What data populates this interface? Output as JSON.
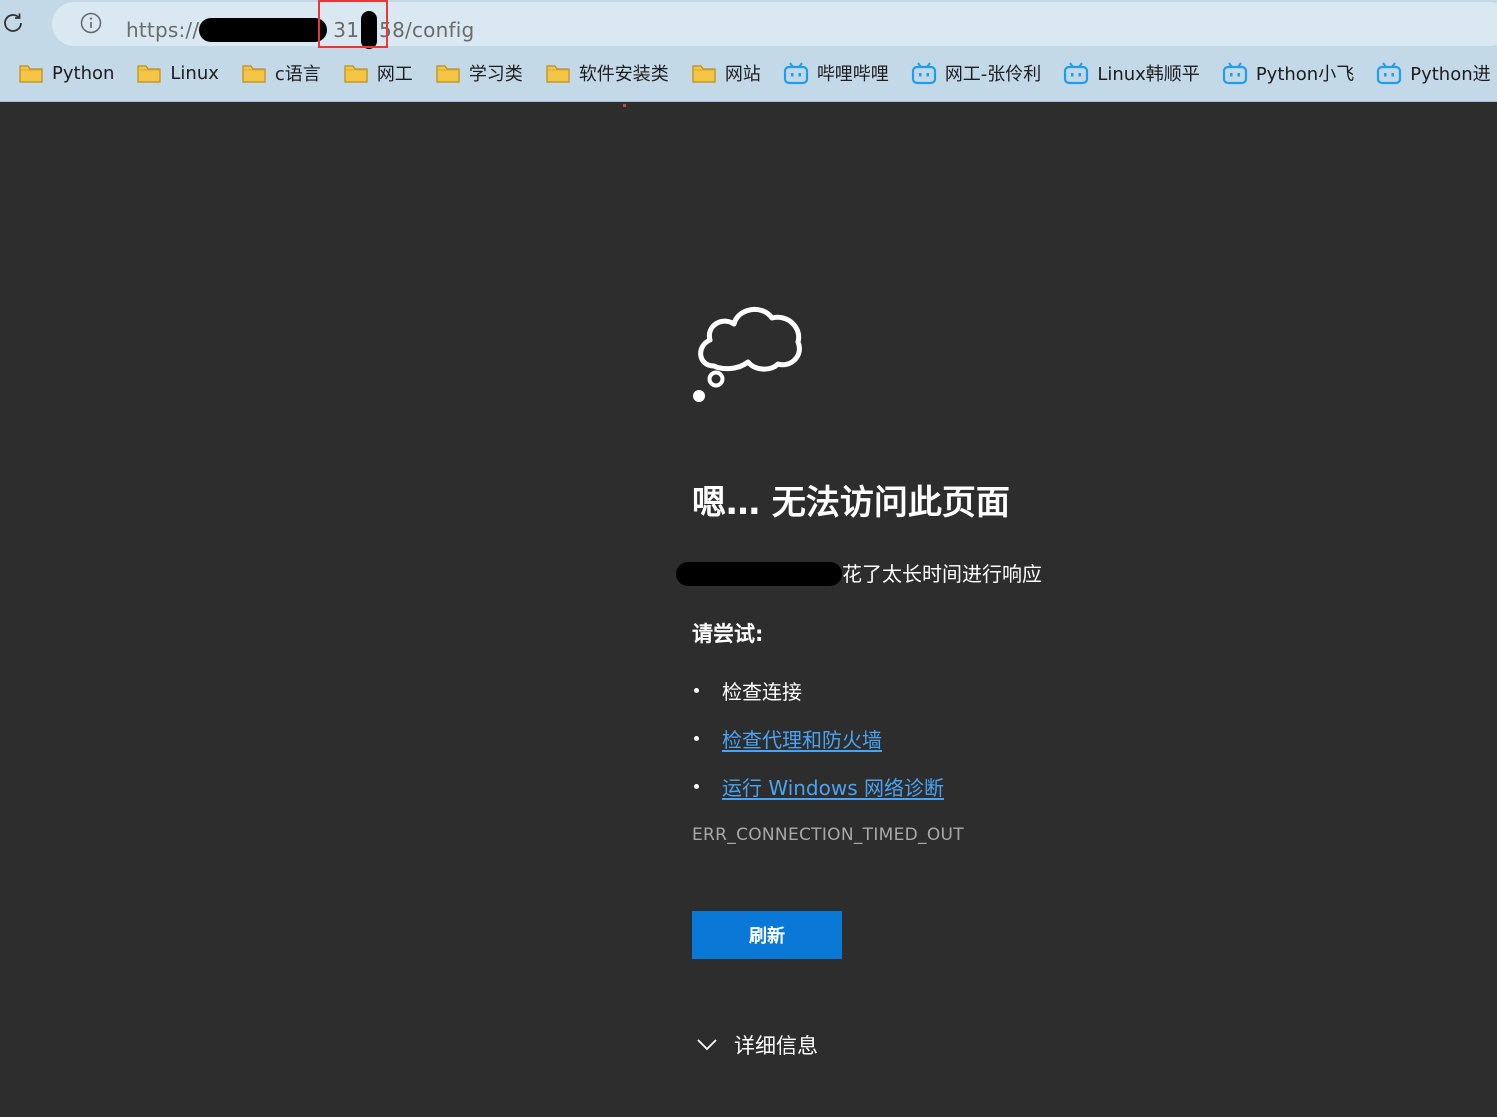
{
  "browser": {
    "url_prefix": "https://",
    "url_visible_1": "31",
    "url_visible_2": "58/config",
    "icons": {
      "reload": "reload-icon",
      "info": "info-icon"
    }
  },
  "bookmarks": [
    {
      "label": "Python",
      "icon": "folder-icon"
    },
    {
      "label": "Linux",
      "icon": "folder-icon"
    },
    {
      "label": "c语言",
      "icon": "folder-icon"
    },
    {
      "label": "网工",
      "icon": "folder-icon"
    },
    {
      "label": "学习类",
      "icon": "folder-icon"
    },
    {
      "label": "软件安装类",
      "icon": "folder-icon"
    },
    {
      "label": "网站",
      "icon": "folder-icon"
    },
    {
      "label": "哔哩哔哩",
      "icon": "bilibili-icon"
    },
    {
      "label": "网工-张伶利",
      "icon": "bilibili-icon"
    },
    {
      "label": "Linux韩顺平",
      "icon": "bilibili-icon"
    },
    {
      "label": "Python小飞",
      "icon": "bilibili-icon"
    },
    {
      "label": "Python进",
      "icon": "bilibili-icon"
    }
  ],
  "error_page": {
    "title": "嗯… 无法访问此页面",
    "subtitle_suffix": "花了太长时间进行响应",
    "try_heading": "请尝试:",
    "suggestions": [
      {
        "label": "检查连接",
        "link": false
      },
      {
        "label": "检查代理和防火墙",
        "link": true
      },
      {
        "label": "运行 Windows 网络诊断",
        "link": true
      }
    ],
    "error_code": "ERR_CONNECTION_TIMED_OUT",
    "refresh_label": "刷新",
    "details_label": "详细信息"
  },
  "colors": {
    "page_bg": "#2d2d2d",
    "chrome_bg": "#c3d9e8",
    "link": "#4aa3f0",
    "button": "#0a78d7",
    "folder": "#f5c645",
    "bilibili": "#1e9fe8",
    "highlight": "#e53935"
  }
}
